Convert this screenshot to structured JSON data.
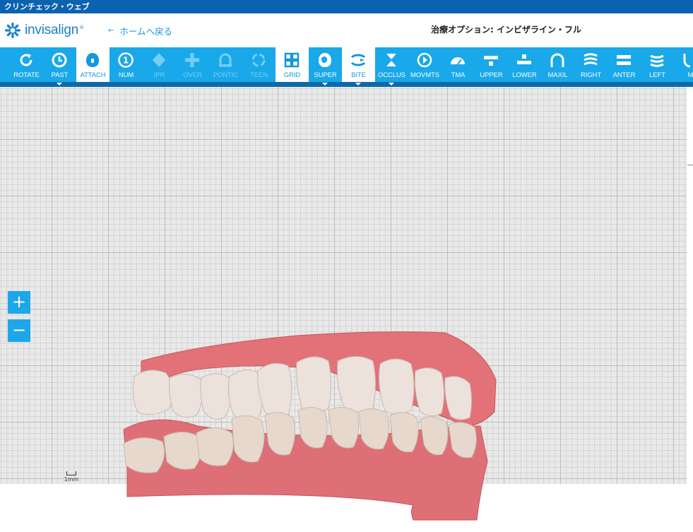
{
  "window": {
    "title": "クリンチェック・ウェブ"
  },
  "header": {
    "logo_text": "invisalign",
    "logo_tm": "®",
    "back_link_label": "ホームへ戻る",
    "back_arrow": "←",
    "page_title": "治療オプション: インビザライン・フル"
  },
  "toolbar": {
    "tools": [
      {
        "label": "ROTATE",
        "icon": "rotate-icon"
      },
      {
        "label": "PAST",
        "icon": "history-clock-icon",
        "dropdown": true
      },
      {
        "label": "ATTACH",
        "icon": "attachment-icon",
        "active": true,
        "indicator": true
      },
      {
        "label": "NUM",
        "icon": "number-circle-icon",
        "icon_text": "1"
      },
      {
        "label": "IPR",
        "icon": "ipr-diamond-icon",
        "disabled": true
      },
      {
        "label": "OVER",
        "icon": "overlay-plus-icon",
        "disabled": true
      },
      {
        "label": "PONTIC",
        "icon": "pontic-icon",
        "disabled": true
      },
      {
        "label": "TEEN",
        "icon": "teen-icon",
        "disabled": true
      },
      {
        "label": "GRID",
        "icon": "grid-icon",
        "active": true,
        "indicator": true
      },
      {
        "label": "SUPER",
        "icon": "superimpose-icon",
        "dropdown": true
      },
      {
        "label": "BITE",
        "icon": "bite-icon",
        "active": true,
        "indicator": true,
        "dropdown": true
      },
      {
        "label": "OCCLUS",
        "icon": "occlusion-icon",
        "dropdown": true
      },
      {
        "label": "MOVMTS",
        "icon": "movements-icon"
      },
      {
        "label": "TMA",
        "icon": "tma-gauge-icon"
      },
      {
        "label": "UPPER",
        "icon": "upper-arch-icon"
      },
      {
        "label": "LOWER",
        "icon": "lower-arch-icon"
      },
      {
        "label": "MAXIL",
        "icon": "maxillary-arch-icon"
      },
      {
        "label": "RIGHT",
        "icon": "right-view-icon"
      },
      {
        "label": "ANTER",
        "icon": "anterior-view-icon"
      },
      {
        "label": "LEFT",
        "icon": "left-view-icon"
      },
      {
        "label": "M",
        "icon": "mandibular-icon"
      }
    ]
  },
  "viewer": {
    "zoom_in_label": "+",
    "zoom_out_label": "−",
    "scale_label": "1mm"
  },
  "colors": {
    "title_bar": "#0a62b0",
    "toolbar": "#19a8e9",
    "toolbar_dark": "#0d6aa8",
    "active_indicator": "#f39a1e",
    "gum": "#df6f77",
    "tooth": "#ede3dc"
  }
}
